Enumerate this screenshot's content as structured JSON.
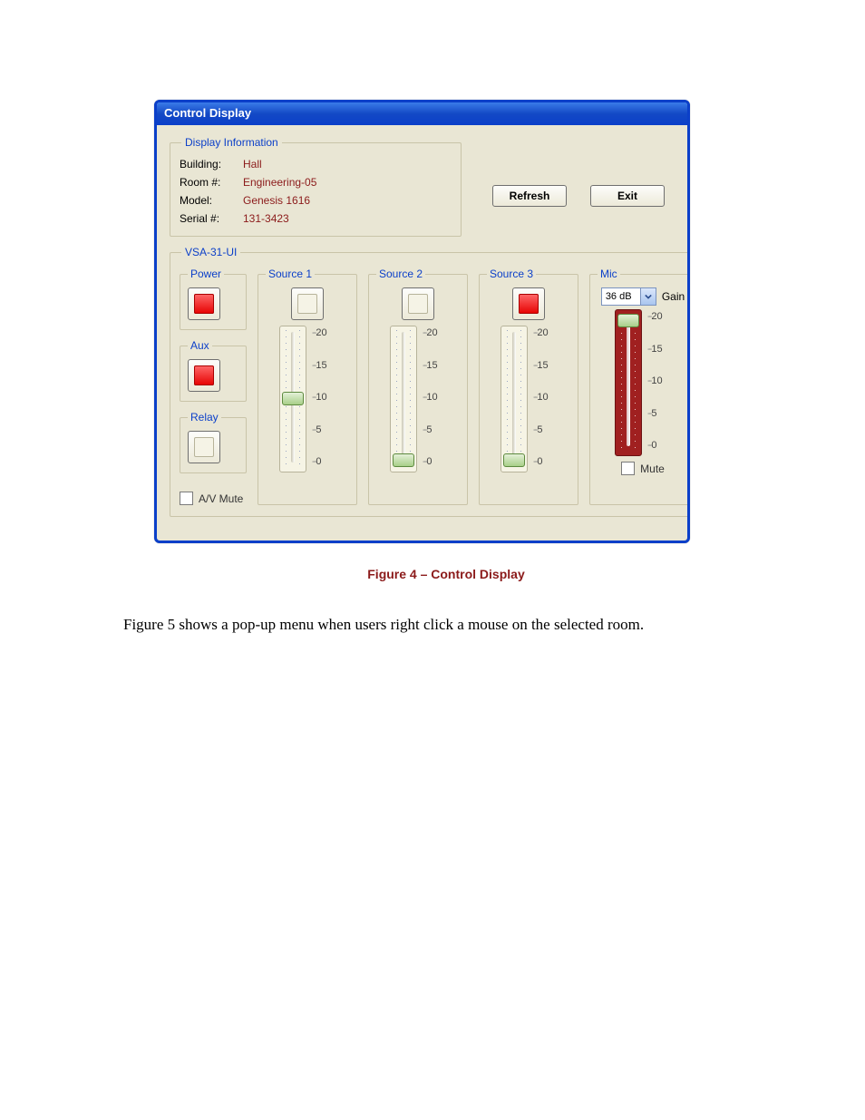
{
  "window": {
    "title": "Control Display"
  },
  "display_info": {
    "legend": "Display Information",
    "fields": {
      "building_label": "Building:",
      "building": "Hall",
      "room_label": "Room #:",
      "room": "Engineering-05",
      "model_label": "Model:",
      "model": "Genesis 1616",
      "serial_label": "Serial #:",
      "serial": "131-3423"
    }
  },
  "buttons": {
    "refresh": "Refresh",
    "exit": "Exit"
  },
  "vsa": {
    "legend": "VSA-31-UI",
    "power_label": "Power",
    "aux_label": "Aux",
    "relay_label": "Relay",
    "avmute_label": "A/V Mute"
  },
  "scale": {
    "t20": "20",
    "t15": "15",
    "t10": "10",
    "t5": "5",
    "t0": "0"
  },
  "sources": {
    "s1": {
      "label": "Source 1"
    },
    "s2": {
      "label": "Source 2"
    },
    "s3": {
      "label": "Source 3"
    }
  },
  "mic": {
    "label": "Mic",
    "gain_value": "36 dB",
    "gain_label": "Gain",
    "mute_label": "Mute"
  },
  "caption": "Figure 4 – Control Display",
  "body_text": "Figure 5 shows a pop-up menu when users right click a mouse on the selected room."
}
